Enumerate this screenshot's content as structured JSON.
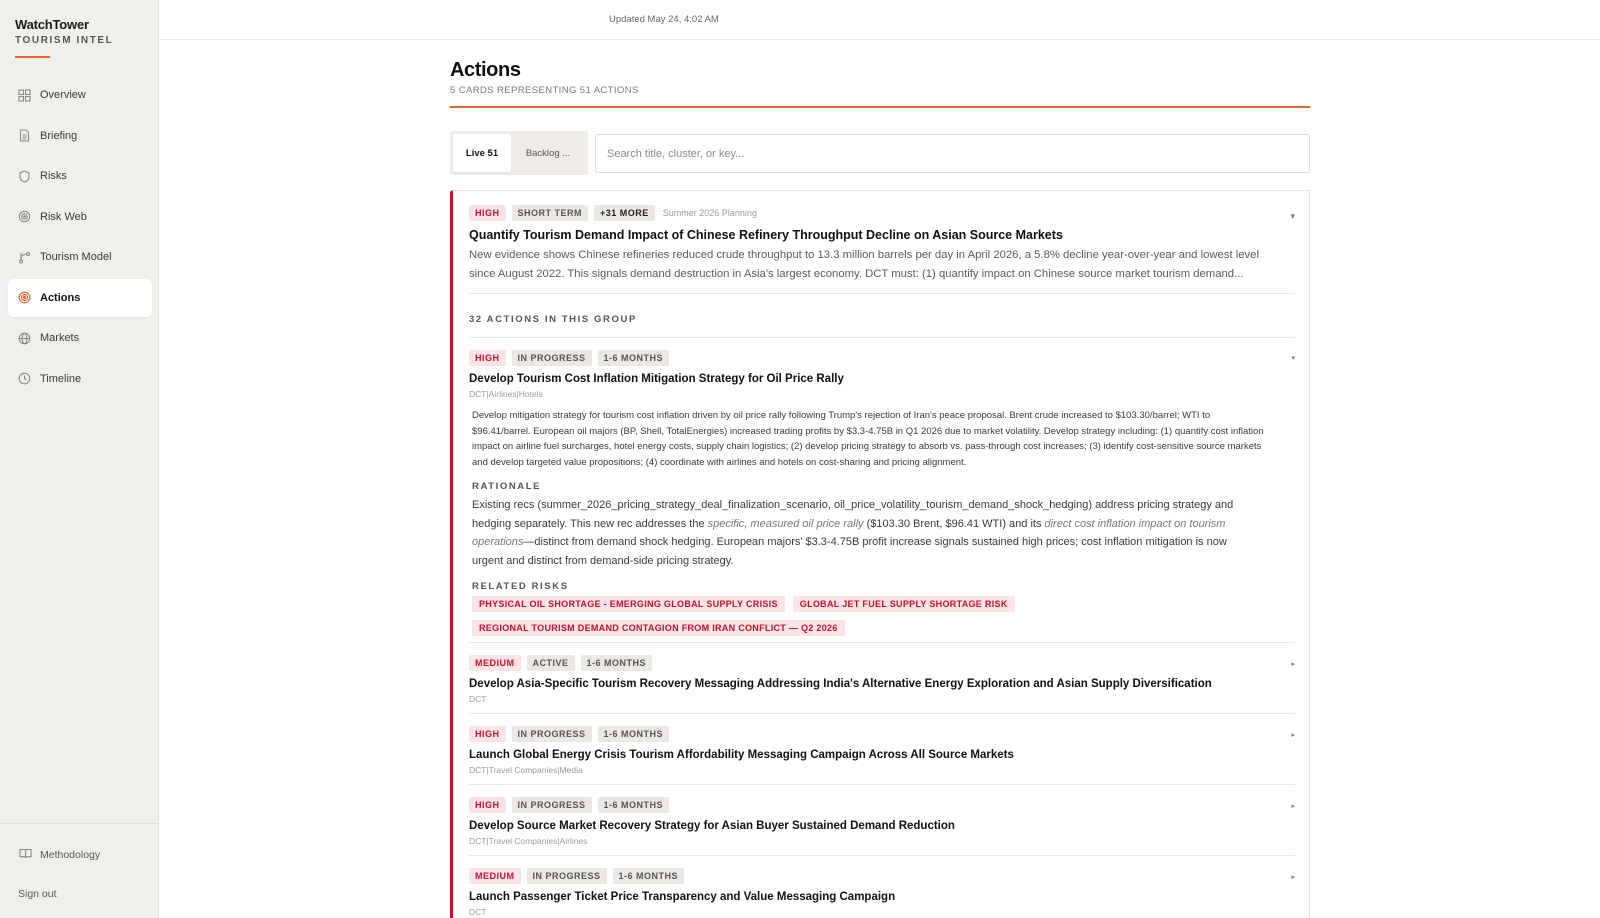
{
  "app": {
    "name": "WatchTower",
    "subtitle": "TOURISM INTEL"
  },
  "sidebar": {
    "items": [
      {
        "label": "Overview",
        "icon": "grid-icon",
        "active": false
      },
      {
        "label": "Briefing",
        "icon": "document-icon",
        "active": false
      },
      {
        "label": "Risks",
        "icon": "shield-icon",
        "active": false
      },
      {
        "label": "Risk Web",
        "icon": "web-icon",
        "active": false
      },
      {
        "label": "Tourism Model",
        "icon": "branch-icon",
        "active": false
      },
      {
        "label": "Actions",
        "icon": "target-icon",
        "active": true
      },
      {
        "label": "Markets",
        "icon": "globe-icon",
        "active": false
      },
      {
        "label": "Timeline",
        "icon": "clock-icon",
        "active": false
      }
    ],
    "methodology": "Methodology",
    "signout": "Sign out"
  },
  "topbar": {
    "updated": "Updated May 24, 4:02 AM"
  },
  "header": {
    "title": "Actions",
    "subtitle": "5 CARDS REPRESENTING 51 ACTIONS"
  },
  "filters": {
    "live": "Live 51",
    "backlog": "Backlog ...",
    "search_placeholder": "Search title, cluster, or key..."
  },
  "colors": {
    "accent": "#e8632b",
    "high": "#c8102e",
    "sidebar_bg": "#f1efeb"
  },
  "card": {
    "tags": [
      "HIGH",
      "SHORT TERM",
      "+31 MORE"
    ],
    "note": "Summer 2026 Planning",
    "title": "Quantify Tourism Demand Impact of Chinese Refinery Throughput Decline on Asian Source Markets",
    "description_line1": "New evidence shows Chinese refineries reduced crude throughput to 13.3 million barrels per day in April 2026, a 5.8% decline year-over-year and lowest level",
    "description_line2": "since August 2022. This signals demand destruction in Asia's largest economy. DCT must: (1) quantify impact on Chinese source market tourism demand...",
    "group_label": "32 ACTIONS IN THIS GROUP",
    "expanded_action": {
      "tags": [
        "HIGH",
        "IN PROGRESS",
        "1-6 MONTHS"
      ],
      "title": "Develop Tourism Cost Inflation Mitigation Strategy for Oil Price Rally",
      "meta": "DCT|Airlines|Hotels",
      "description": [
        "Develop mitigation strategy for tourism cost inflation driven by oil price rally following Trump's rejection of Iran's peace proposal. Brent crude increased to $103.30/barrel; WTI to",
        "$96.41/barrel. European oil majors (BP, Shell, TotalEnergies) increased trading profits by $3.3-4.75B in Q1 2026 due to market volatility. Develop strategy including: (1) quantify cost inflation",
        "impact on airline fuel surcharges, hotel energy costs, supply chain logistics; (2) develop pricing strategy to absorb vs. pass-through cost increases; (3) identify cost-sensitive source markets",
        "and develop targeted value propositions; (4) coordinate with airlines and hotels on cost-sharing and pricing alignment."
      ],
      "rationale_label": "RATIONALE",
      "rationale": {
        "p1": "Existing recs (summer_2026_pricing_strategy_deal_finalization_scenario, oil_price_volatility_tourism_demand_shock_hedging) address pricing strategy and",
        "p2a": "hedging separately. This new rec addresses the ",
        "p2em": "specific, measured oil price rally",
        "p2b": " ($103.30 Brent, $96.41 WTI) and its ",
        "p2em2": "direct cost inflation impact on tourism",
        "p3em": "operations",
        "p3b": "—distinct from demand shock hedging. European majors' $3.3-4.75B profit increase signals sustained high prices; cost inflation mitigation is now",
        "p4": "urgent and distinct from demand-side pricing strategy."
      },
      "related_label": "RELATED RISKS",
      "related_risks": [
        "PHYSICAL OIL SHORTAGE - EMERGING GLOBAL SUPPLY CRISIS",
        "GLOBAL JET FUEL SUPPLY SHORTAGE RISK",
        "REGIONAL TOURISM DEMAND CONTAGION FROM IRAN CONFLICT — Q2 2026"
      ]
    },
    "actions": [
      {
        "tags": [
          "MEDIUM",
          "ACTIVE",
          "1-6 MONTHS"
        ],
        "title": "Develop Asia-Specific Tourism Recovery Messaging Addressing India's Alternative Energy Exploration and Asian Supply Diversification",
        "meta": "DCT"
      },
      {
        "tags": [
          "HIGH",
          "IN PROGRESS",
          "1-6 MONTHS"
        ],
        "title": "Launch Global Energy Crisis Tourism Affordability Messaging Campaign Across All Source Markets",
        "meta": "DCT|Travel Companies|Media"
      },
      {
        "tags": [
          "HIGH",
          "IN PROGRESS",
          "1-6 MONTHS"
        ],
        "title": "Develop Source Market Recovery Strategy for Asian Buyer Sustained Demand Reduction",
        "meta": "DCT|Travel Companies|Airlines"
      },
      {
        "tags": [
          "MEDIUM",
          "IN PROGRESS",
          "1-6 MONTHS"
        ],
        "title": "Launch Passenger Ticket Price Transparency and Value Messaging Campaign",
        "meta": "DCT"
      }
    ]
  }
}
